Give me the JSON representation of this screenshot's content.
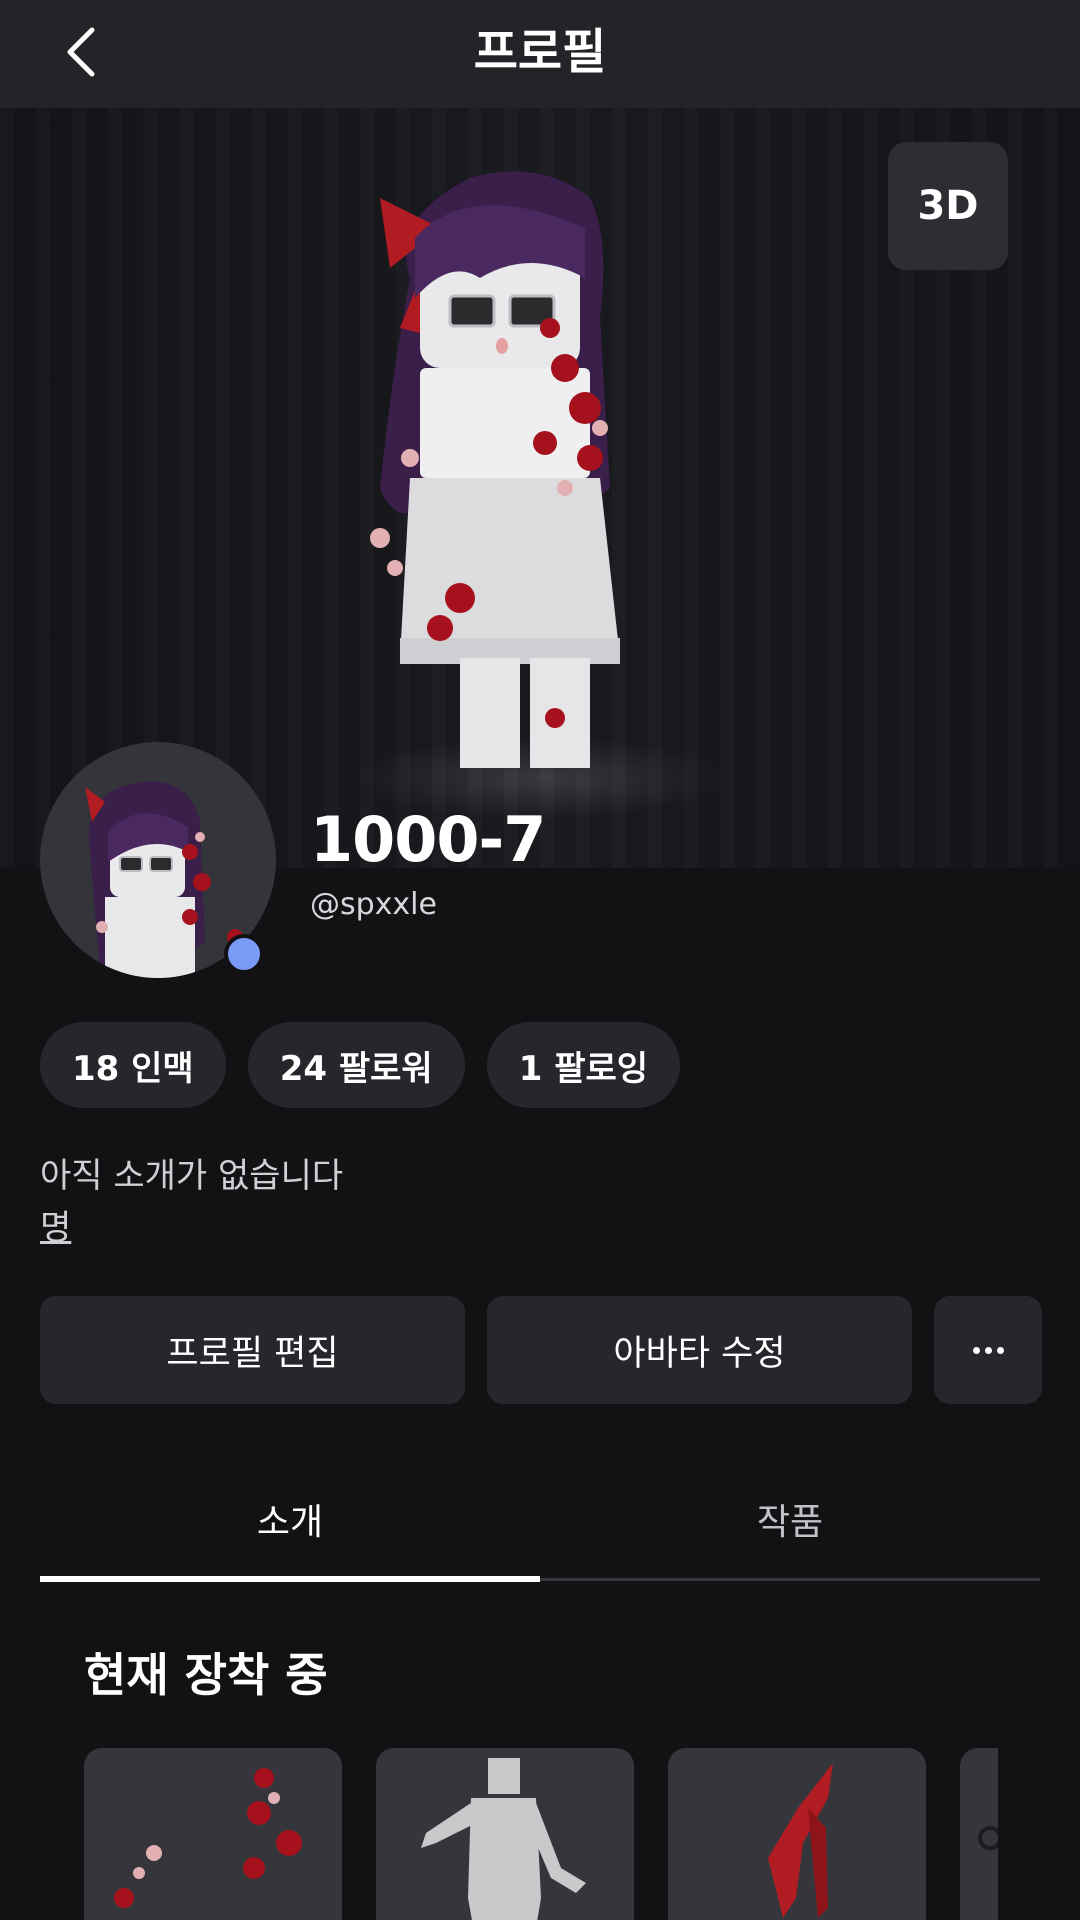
{
  "header": {
    "title": "프로필"
  },
  "hero": {
    "view_mode_label": "3D"
  },
  "profile": {
    "display_name": "1000-7",
    "username": "@spxxle",
    "online_color": "#7a9bf5"
  },
  "stats": [
    {
      "label": "18 인맥"
    },
    {
      "label": "24 팔로워"
    },
    {
      "label": "1 팔로잉"
    }
  ],
  "bio": {
    "text": "아직 소개가 없습니다",
    "more_label": "명"
  },
  "actions": {
    "edit_profile": "프로필 편집",
    "edit_avatar": "아바타 수정"
  },
  "tabs": [
    {
      "label": "소개",
      "active": true
    },
    {
      "label": "작품",
      "active": false
    }
  ],
  "section": {
    "title": "현재 장착 중"
  },
  "equipped_items": [
    {
      "icon": "flower-accessory-icon"
    },
    {
      "icon": "body-model-icon"
    },
    {
      "icon": "red-ribbon-icon"
    },
    {
      "icon": "accessory-icon"
    }
  ]
}
